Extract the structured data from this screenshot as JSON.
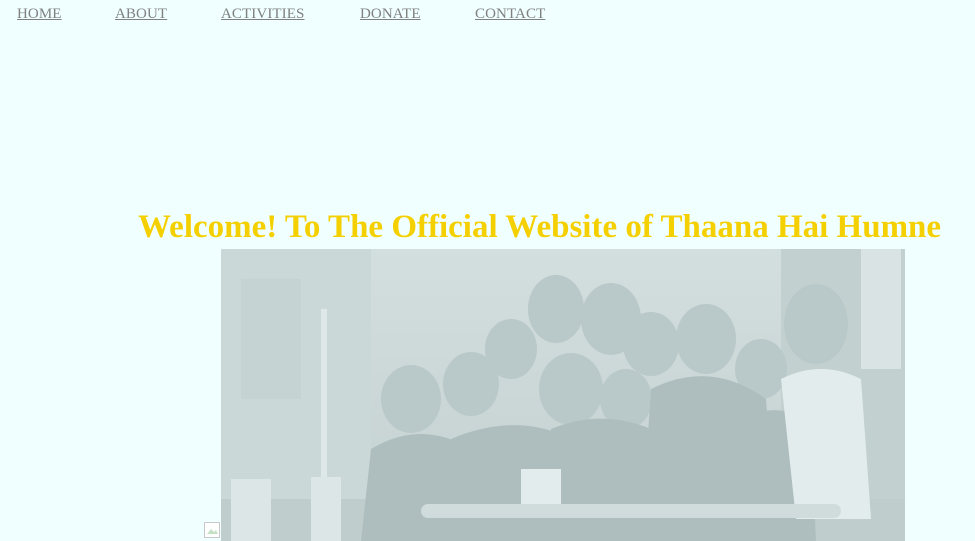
{
  "nav": {
    "items": [
      {
        "label": "HOME"
      },
      {
        "label": "ABOUT"
      },
      {
        "label": "ACTIVITIES"
      },
      {
        "label": "DONATE"
      },
      {
        "label": "CONTACT"
      }
    ],
    "color": "#808080"
  },
  "hero": {
    "headline": "Welcome! To The Official Website of Thaana Hai Humne",
    "headline_color": "#f5d000",
    "image_icon": "group-of-children-photo",
    "broken_image_icon": "broken-image-icon"
  },
  "colors": {
    "background": "#f0ffff",
    "photo_tint": "#c9d8d8"
  }
}
